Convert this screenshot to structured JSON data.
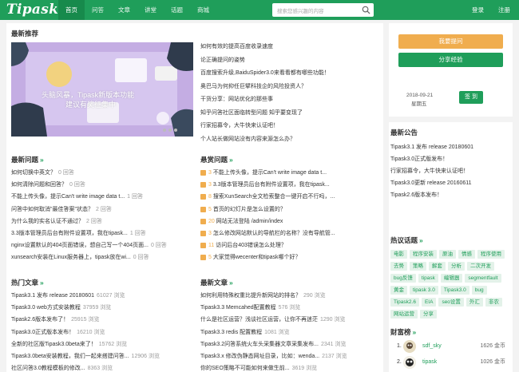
{
  "brand": {
    "logo": "Tipask",
    "accent": "#1f9e5a"
  },
  "nav": {
    "items": [
      {
        "label": "首页",
        "active": true
      },
      {
        "label": "问答"
      },
      {
        "label": "文章"
      },
      {
        "label": "讲堂"
      },
      {
        "label": "话题"
      },
      {
        "label": "商城"
      }
    ],
    "search_placeholder": "搜索您感兴趣的内容",
    "login": "登录",
    "register": "注册"
  },
  "recommend": {
    "title": "最新推荐",
    "hero_caption_line1": "头脑风暴，Tipask新版本功能",
    "hero_caption_line2": "建议有奖征集中",
    "items": [
      "如何有效的提高百度收录速度",
      "论正确提问的姿势",
      "百度搜索升级,BaiduSpider3.0来看看都有哪些功能！",
      "奥巴马为何抑任巨擘科技企的风险投资人？",
      "干货分享：网站优化的那些事",
      "知乎问答社区面临转型问题 知乎要变现了",
      "行家招募令，大牛快来认证吧！",
      "个人站长做网站没有内容来源怎么办？"
    ]
  },
  "new_questions": {
    "title": "最新问题",
    "items": [
      {
        "t": "如何切换中英文？",
        "m": "0 回答"
      },
      {
        "t": "如何清除问题和回答？",
        "m": "0 回答"
      },
      {
        "t": "不能上传头像，提示Can't write image data t...",
        "m": "1 回答"
      },
      {
        "t": "问答中如何取消\"最佳答案\"状态？",
        "m": "2 回答"
      },
      {
        "t": "为什么我的实名认证不通过？",
        "m": "2 回答"
      },
      {
        "t": "3.3版本管理员后台有附件设置项，我在tipask...",
        "m": "1 回答"
      },
      {
        "t": "nginx设置默认的404页面错误，想自己写一个404页面...",
        "m": "0 回答"
      },
      {
        "t": "xunsearch安装在Linux服务器上，tipask放在wi...",
        "m": "0 回答"
      }
    ]
  },
  "bounty": {
    "title": "悬赏问题",
    "items": [
      {
        "n": "3",
        "t": "不能上传头像，提示Can't write image data t..."
      },
      {
        "n": "3",
        "t": "3.3版本管理员后台有附件设置项，我在tipask..."
      },
      {
        "n": "8",
        "t": "搜索XunSearch全文检索整合一键开启不行吗，..."
      },
      {
        "n": "5",
        "t": "首页的幻灯片是怎么设置的？"
      },
      {
        "n": "20",
        "t": "网站无法登陆 /admin/index"
      },
      {
        "n": "3",
        "t": "怎么修改网站默认的导航栏的名称？没有导航管..."
      },
      {
        "n": "11",
        "t": "访问后台403错误怎么处理？"
      },
      {
        "n": "5",
        "t": "大家觉得wecenter和tipask哪个好？"
      }
    ]
  },
  "hot_articles": {
    "title": "热门文章",
    "items": [
      {
        "t": "Tipask3.1 发布 release 20180601",
        "m": "61027 浏览"
      },
      {
        "t": "Tipask3.0 web方式安装教程",
        "m": "37959 浏览"
      },
      {
        "t": "Tipask2.6版本发布了！",
        "m": "25915 浏览"
      },
      {
        "t": "Tipask3.0正式版本发布！",
        "m": "16210 浏览"
      },
      {
        "t": "全新的社区版Tipask3.0beta来了！",
        "m": "15762 浏览"
      },
      {
        "t": "Tipask3.0beta安装教程，我们一起来搭建问答...",
        "m": "12906 浏览"
      },
      {
        "t": "社区问答3.0教程模板的修改...",
        "m": "8363 浏览"
      }
    ]
  },
  "new_articles": {
    "title": "最新文章",
    "items": [
      {
        "t": "如何利用特殊权重比提升新网站的排名？",
        "m": "290 浏览"
      },
      {
        "t": "Tipask3.3 Memcahed配置教程",
        "m": "576 浏览"
      },
      {
        "t": "什么是社区运营？浅谈社区运营，让你不再迷茫",
        "m": "1290 浏览"
      },
      {
        "t": "Tipask3.3 redis 配置教程",
        "m": "1081 浏览"
      },
      {
        "t": "Tipask3.2问答系统火车头采集器文章采集发布...",
        "m": "2341 浏览"
      },
      {
        "t": "Tipask3.x 修改伪静态网址目录，比如：wenda...",
        "m": "2137 浏览"
      },
      {
        "t": "你的SEO策略不可能如何来做生前...",
        "m": "3619 浏览"
      }
    ]
  },
  "sidebar": {
    "ask_button": "我要提问",
    "share_button": "分享经验",
    "checkin_date": "2018-09-21",
    "checkin_weekday": "星期五",
    "checkin_button": "签 到",
    "announce_title": "最新公告",
    "announcements": [
      "Tipask3.1 发布 release 20180601",
      "Tipask3.0正式版发布！",
      "行家招募令，大牛快来认证吧！",
      "Tipask3.0更新 release 20160611",
      "Tipask2.6版本发布！"
    ],
    "topics_title": "热议话题",
    "tags": [
      "电影",
      "程序安装",
      "原油",
      "情感",
      "程序使用",
      "去势",
      "策略",
      "解套",
      "分析",
      "二次开发",
      "bug反馈",
      "tipask",
      "编辑器",
      "segmentfault",
      "黄金",
      "tipask 3.0",
      "Tipask3.0",
      "bug",
      "Tipask2.6",
      "EIA",
      "seo设置",
      "外汇",
      "非农",
      "网站运营",
      "分享"
    ],
    "rich_title": "财富榜",
    "rich": [
      {
        "rank": "1.",
        "name": "sdf_sky",
        "points": "1626 金币"
      },
      {
        "rank": "2.",
        "name": "tipask",
        "points": "1026 金币"
      }
    ]
  }
}
